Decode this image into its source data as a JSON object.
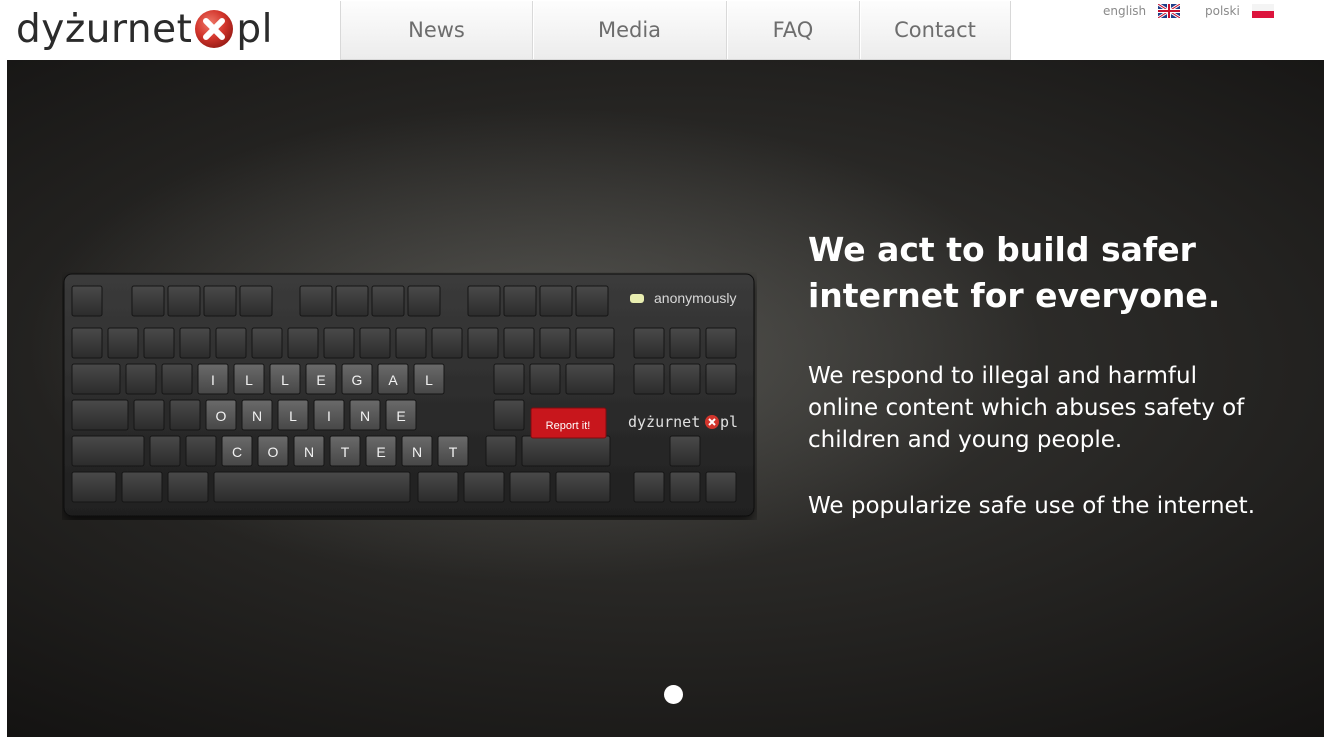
{
  "logo": {
    "left": "dyżurnet",
    "right": "pl"
  },
  "nav": {
    "items": [
      "News",
      "Media",
      "FAQ",
      "Contact"
    ]
  },
  "languages": {
    "english": "english",
    "polski": "polski"
  },
  "hero": {
    "headline_line1": "We act to build safer",
    "headline_line2": "internet for everyone.",
    "paragraph1_line1": "We respond to illegal and harmful",
    "paragraph1_line2": "online content which abuses safety of",
    "paragraph1_line3": "children and young people.",
    "paragraph2": "We popularize safe use of the internet.",
    "keyboard": {
      "indicator": "anonymously",
      "row_illegal": [
        "I",
        "L",
        "L",
        "E",
        "G",
        "A",
        "L"
      ],
      "row_online": [
        "O",
        "N",
        "L",
        "I",
        "N",
        "E"
      ],
      "row_content": [
        "C",
        "O",
        "N",
        "T",
        "E",
        "N",
        "T"
      ],
      "report_key": "Report it!",
      "brand_left": "dyżurnet",
      "brand_right": "pl"
    }
  },
  "colors": {
    "brand_red": "#c9302c",
    "report_key": "#c8161c",
    "hero_dark": "#252422"
  }
}
